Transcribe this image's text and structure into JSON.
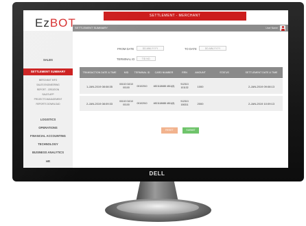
{
  "monitor": {
    "brand": "DELL"
  },
  "app": {
    "logo_main": "Ez",
    "logo_accent": "BOT",
    "banner": "SETTLEMENT  - MERCHANT",
    "subbar_title": "SETTLEMENT SUMMARY",
    "user_name": "User Name"
  },
  "sidebar": {
    "items": [
      {
        "label": "SALES",
        "active": false
      },
      {
        "label": "SETTLEMENT SUMMARY",
        "active": true
      },
      {
        "label": "LOGISTICS",
        "active": false
      },
      {
        "label": "OPERATIONS",
        "active": false
      },
      {
        "label": "FINANCIAL ACCOUNTING",
        "active": false
      },
      {
        "label": "TECHNOLOGY",
        "active": false
      },
      {
        "label": "BUSINESS ANALYTICS",
        "active": false
      },
      {
        "label": "HR",
        "active": false
      }
    ],
    "subitems": [
      "MERCHANT INFO",
      "SALES ENGINEERING",
      "REPORT - CREATION",
      "SALES APP",
      "PROJECTS MANAGEMENT",
      "REPORTS DOWNLOAD"
    ]
  },
  "filters": {
    "from_label": "FROM DATE",
    "from_placeholder": "DD-MM-YYYY",
    "to_label": "TO DATE",
    "to_placeholder": "DD-MM-YYYY",
    "terminal_label": "TERMINAL ID",
    "terminal_value": "TID NO."
  },
  "table": {
    "headers": [
      "TRANSACTION DATE & TIME",
      "MID",
      "TERMINAL ID",
      "CARD NUMBER",
      "RRN",
      "AMOUNT",
      "STATUS",
      "SETTLEMENT DATE & TIME"
    ],
    "rows": [
      [
        "1-JAN-2019  08:08:35",
        "00102 01010 00100",
        "00102010",
        "4821118688 4811(8)",
        "912313 101132",
        "1000",
        "",
        "2-JAN-2019  09:08:13"
      ],
      [
        "2-JAN-2019  08:09:33",
        "00102 01010 00100",
        "00102010",
        "4821118688 4811(8)",
        "912313 106311",
        "2000",
        "",
        "2-JAN-2019  10:09:13"
      ]
    ]
  },
  "buttons": {
    "reset": "RESET",
    "submit": "SUBMIT"
  },
  "colors": {
    "accent": "#cc1d1d",
    "header_gray": "#8a8a8a",
    "submit": "#6fc46b",
    "reset": "#f2b38e"
  }
}
